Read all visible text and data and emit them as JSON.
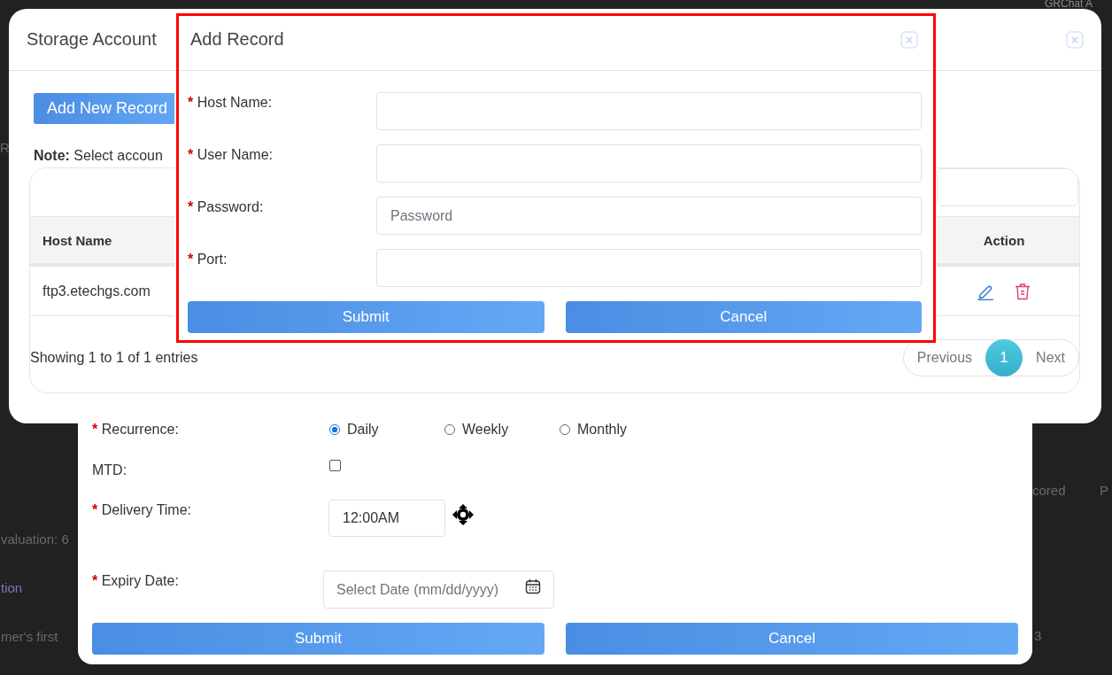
{
  "background": {
    "header_text": "GRChat A",
    "fragments": [
      "R",
      "valuation: 6",
      "tion",
      "mer's first",
      "cored",
      "P",
      "3"
    ]
  },
  "schedule_form": {
    "fields": [
      {
        "kind": "radio",
        "required_mark": "*",
        "label": "Recurrence:",
        "options": [
          {
            "label": "Daily",
            "selected": true
          },
          {
            "label": "Weekly",
            "selected": false
          },
          {
            "label": "Monthly",
            "selected": false
          }
        ]
      },
      {
        "kind": "checkbox",
        "label": "MTD:",
        "checked": false
      },
      {
        "kind": "time",
        "required_mark": "*",
        "label": "Delivery Time:",
        "value": "12:00AM"
      },
      {
        "kind": "date",
        "required_mark": "*",
        "label": "Expiry Date:",
        "placeholder": "Select Date (mm/dd/yyyy)"
      }
    ],
    "buttons": [
      "Submit",
      "Cancel"
    ]
  },
  "storage_dialog": {
    "title": "Storage Account",
    "add_button": "Add New Record",
    "note": "**Note:** Select accoun",
    "table": {
      "columns": [
        "Host Name",
        "Action"
      ],
      "rows": [
        {
          "host_name": "ftp3.etechgs.com"
        }
      ]
    },
    "info": "Showing 1 to 1 of 1 entries",
    "pagination": {
      "previous": "Previous",
      "pages": [
        {
          "label": "1",
          "selected": true
        }
      ],
      "next": "Next"
    }
  },
  "add_record_dialog": {
    "title": "Add Record",
    "fields": [
      {
        "required_mark": "*",
        "label": "Host Name:"
      },
      {
        "required_mark": "*",
        "label": "User Name:"
      },
      {
        "required_mark": "*",
        "label": "Password:",
        "placeholder": "Password"
      },
      {
        "required_mark": "*",
        "label": "Port:"
      }
    ],
    "buttons": [
      "Submit",
      "Cancel"
    ]
  }
}
